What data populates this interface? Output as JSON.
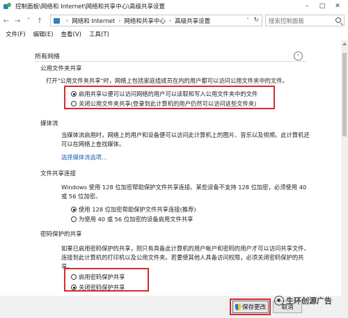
{
  "window": {
    "title": "控制面板\\网络和 Internet\\网络和共享中心\\高级共享设置"
  },
  "address": {
    "crumbs": [
      "网络和 Internet",
      "网络和共享中心",
      "高级共享设置"
    ],
    "search_placeholder": "搜索控制面板"
  },
  "menu": {
    "file": "文件(F)",
    "edit": "编辑(E)",
    "view": "查看(V)",
    "tools": "工具(T)"
  },
  "sections": {
    "all_networks": "所有网络",
    "public_folder": {
      "title": "公用文件夹共享",
      "desc": "打开\"公用文件夹共享\"时，网络上包括家庭组成员在内的用户都可以访问公用文件夹中的文件。",
      "opt_on": "启用共享以便可以访问网络的用户可以读取和写入公用文件夹中的文件",
      "opt_off": "关闭公用文件夹共享(登录到此计算机的用户仍然可以访问这些文件夹)",
      "selected": "on"
    },
    "media": {
      "title": "媒体流",
      "desc": "当媒体流启用时，网络上的用户和设备便可以访问此计算机上的图片、音乐以及视频。此计算机还可以在网络上查找媒体。",
      "link": "选择媒体流选项..."
    },
    "file_sharing": {
      "title": "文件共享连接",
      "desc": "Windows 使用 128 位加密帮助保护文件共享连接。某些设备不支持 128 位加密，必须使用 40 或 56 位加密。",
      "opt_128": "使用 128 位加密帮助保护文件共享连接(推荐)",
      "opt_40": "为使用 40 或 56 位加密的设备启用文件共享",
      "selected": "128"
    },
    "password": {
      "title": "密码保护的共享",
      "desc": "如果已启用密码保护的共享，则只有具备此计算机的用户帐户和密码的用户才可以访问共享文件、连接到此计算机的打印机以及公用文件夹。若要使其他人具备访问权限，必须关闭密码保护的共享。",
      "opt_on": "启用密码保护共享",
      "opt_off": "关闭密码保护共享",
      "selected": "off"
    }
  },
  "buttons": {
    "save": "保存更改",
    "cancel": "取消"
  },
  "watermark": "生环创源广告",
  "colors": {
    "highlight_box": "#d42a2a",
    "link": "#1a5fb4"
  }
}
